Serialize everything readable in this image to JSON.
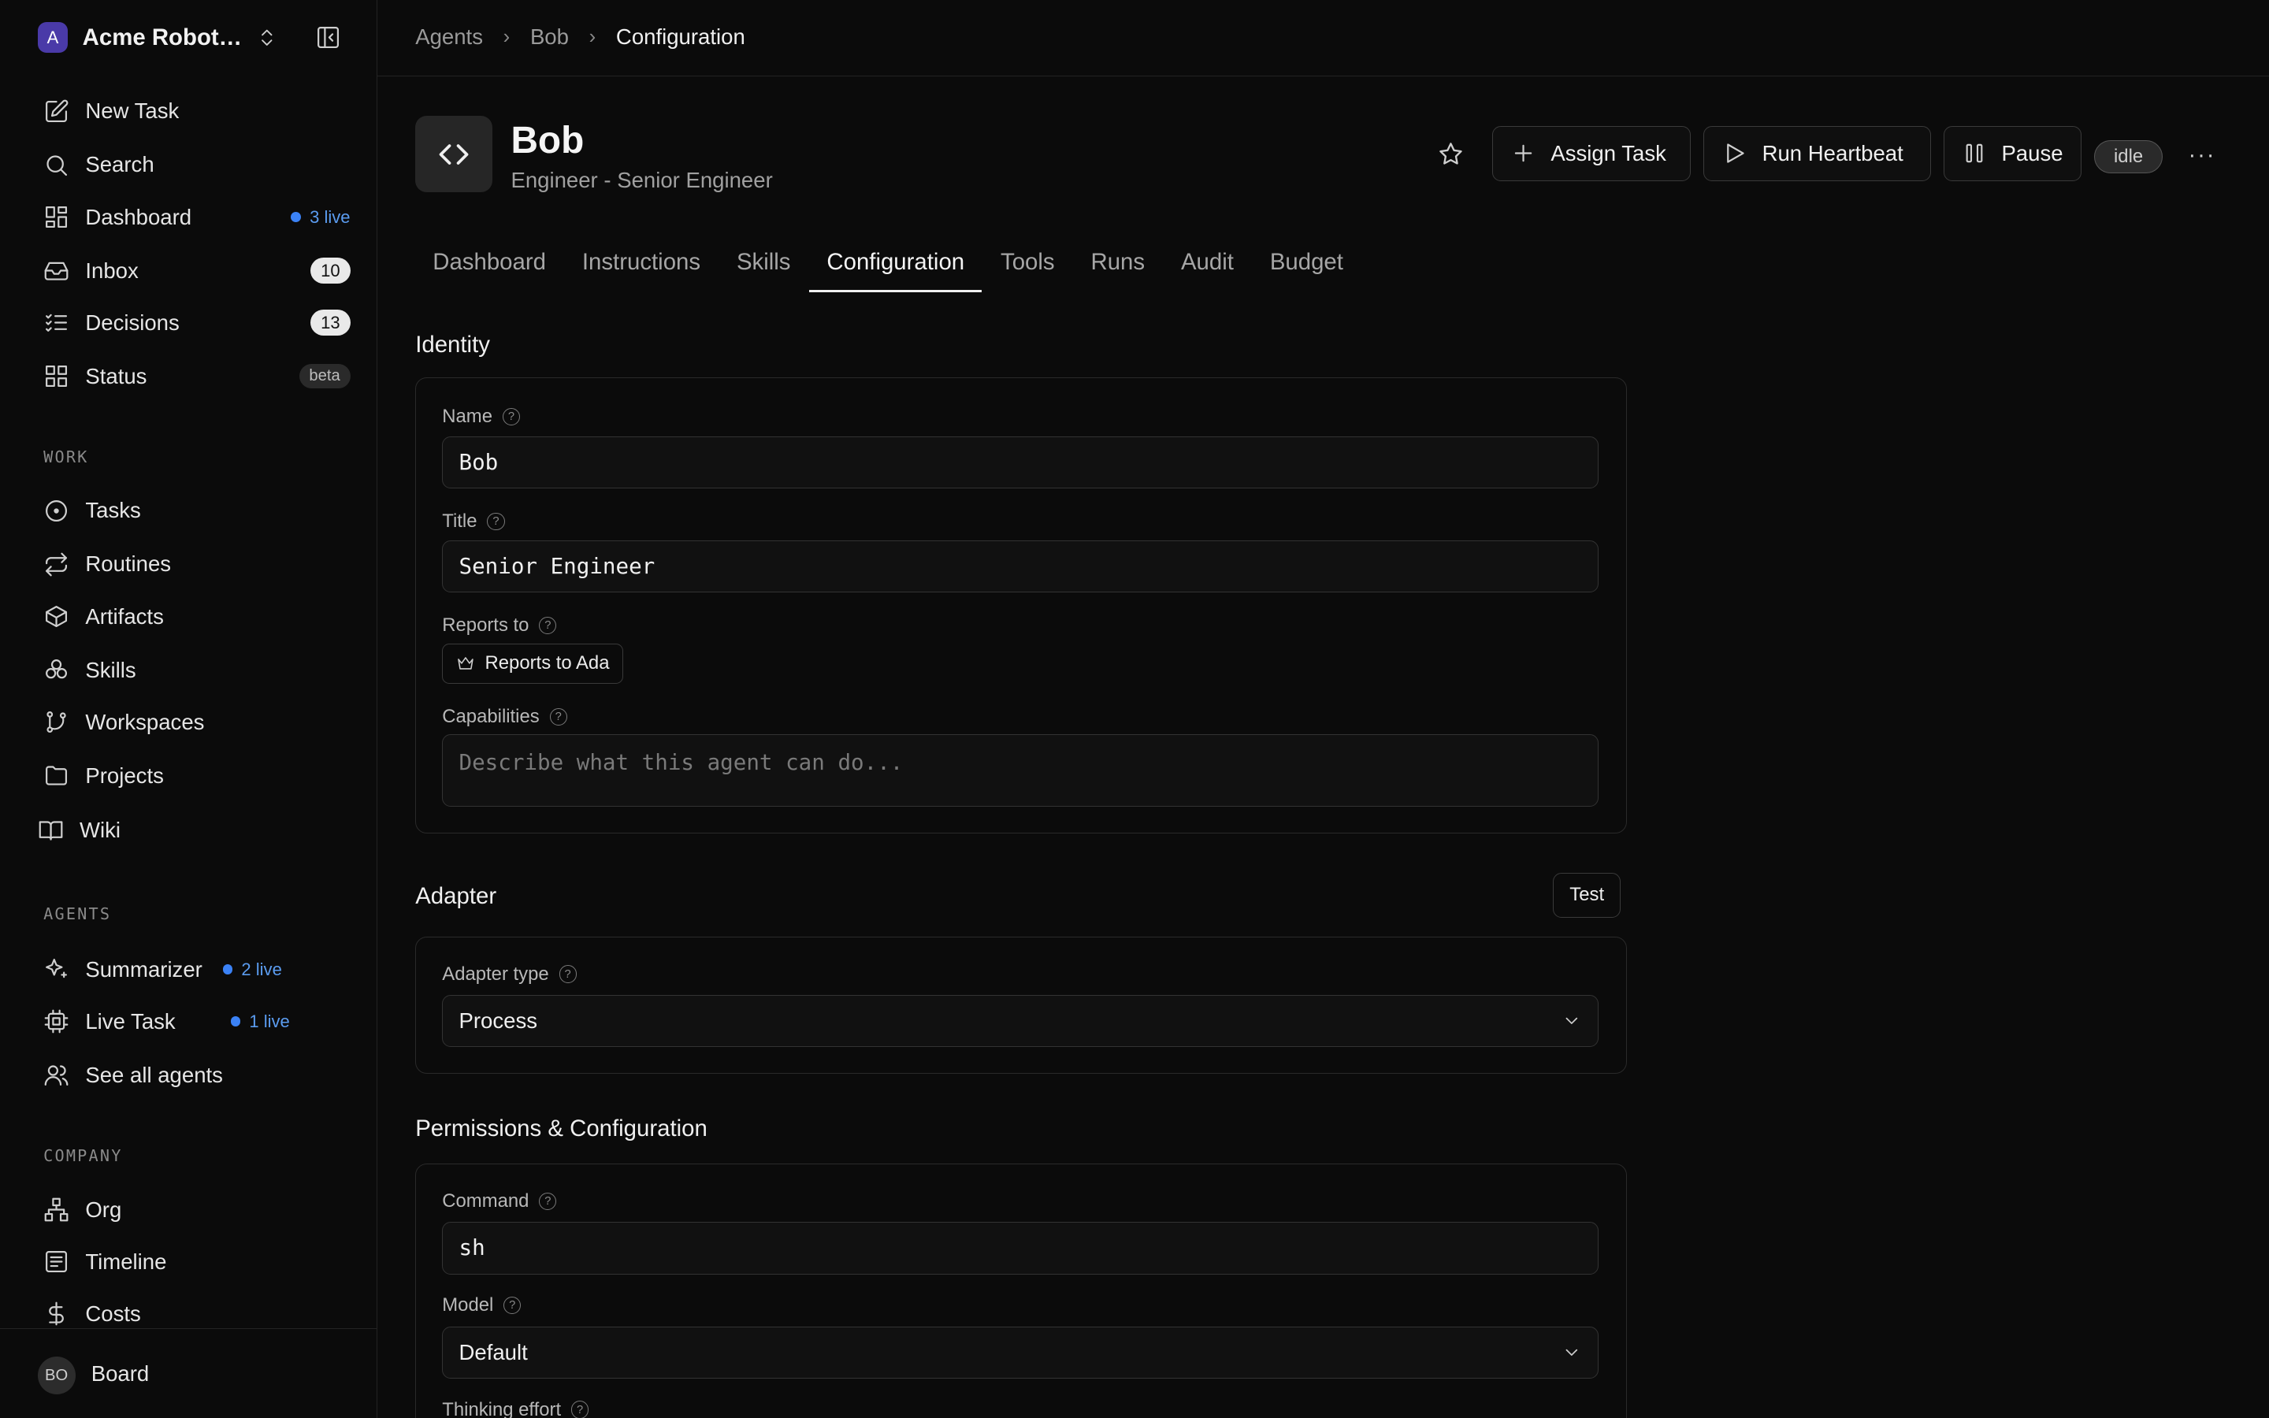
{
  "company": {
    "initial": "A",
    "name": "Acme Robotics"
  },
  "nav_top": [
    {
      "label": "New Task",
      "icon": "edit-icon"
    },
    {
      "label": "Search",
      "icon": "search-icon"
    },
    {
      "label": "Dashboard",
      "icon": "dashboard-icon",
      "live": "3 live"
    },
    {
      "label": "Inbox",
      "icon": "inbox-icon",
      "count": "10"
    },
    {
      "label": "Decisions",
      "icon": "checklist-icon",
      "count": "13"
    },
    {
      "label": "Status",
      "icon": "status-icon",
      "badge": "beta"
    }
  ],
  "sections": {
    "work": "WORK",
    "agents": "AGENTS",
    "company": "COMPANY"
  },
  "nav_work": [
    "Tasks",
    "Routines",
    "Artifacts",
    "Skills",
    "Workspaces",
    "Projects",
    "Wiki"
  ],
  "nav_agents": [
    {
      "label": "Summarizer",
      "live": "2 live"
    },
    {
      "label": "Live Task",
      "live": "1 live"
    },
    {
      "label": "See all agents"
    }
  ],
  "nav_company": [
    "Org",
    "Timeline",
    "Costs"
  ],
  "user": {
    "initials": "BO",
    "name": "Board"
  },
  "breadcrumb": [
    "Agents",
    "Bob",
    "Configuration"
  ],
  "agent": {
    "name": "Bob",
    "subtitle": "Engineer - Senior Engineer",
    "status": "idle"
  },
  "actions": {
    "assign": "Assign Task",
    "heartbeat": "Run Heartbeat",
    "pause": "Pause",
    "more": "···"
  },
  "tabs": [
    "Dashboard",
    "Instructions",
    "Skills",
    "Configuration",
    "Tools",
    "Runs",
    "Audit",
    "Budget"
  ],
  "identity": {
    "heading": "Identity",
    "name_label": "Name",
    "name_value": "Bob",
    "title_label": "Title",
    "title_value": "Senior Engineer",
    "reports_label": "Reports to",
    "reports_value": "Reports to Ada",
    "cap_label": "Capabilities",
    "cap_placeholder": "Describe what this agent can do..."
  },
  "adapter": {
    "heading": "Adapter",
    "test": "Test",
    "type_label": "Adapter type",
    "type_value": "Process"
  },
  "perms": {
    "heading": "Permissions & Configuration",
    "command_label": "Command",
    "command_value": "sh",
    "model_label": "Model",
    "model_value": "Default",
    "effort_label": "Thinking effort"
  },
  "colors": {
    "accent_live": "#3b82f6",
    "logo": "#4a3aa8"
  }
}
